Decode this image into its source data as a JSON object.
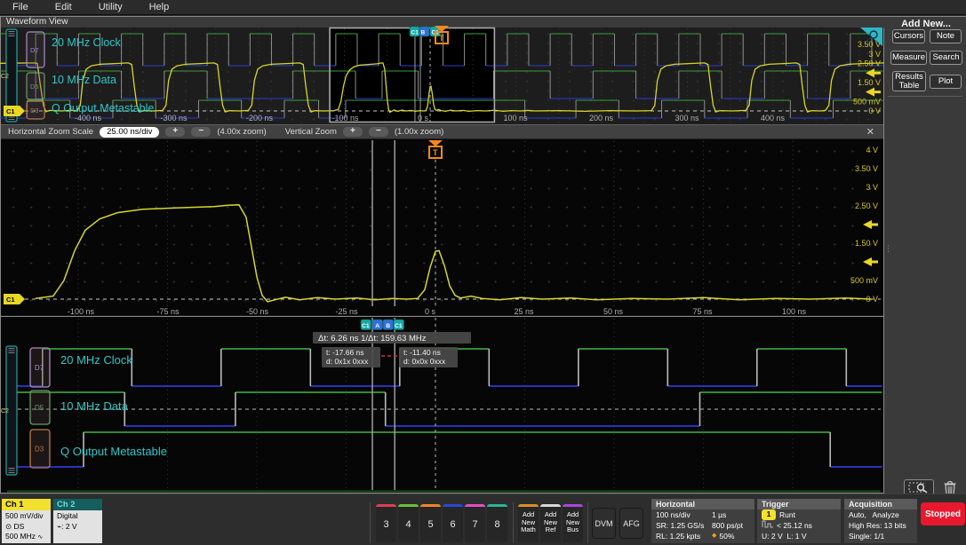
{
  "menu": {
    "items": [
      "File",
      "Edit",
      "Utility",
      "Help"
    ]
  },
  "view": {
    "title": "Waveform View"
  },
  "zoom_bar": {
    "h_label": "Horizontal Zoom Scale",
    "h_scale": "25.00 ns/div",
    "plus": "+",
    "minus": "−",
    "h_zoom": "(4.00x zoom)",
    "v_label": "Vertical Zoom",
    "v_zoom": "(1.00x zoom)",
    "close": "✕"
  },
  "sidebar": {
    "title": "Add New...",
    "buttons": [
      "Cursors",
      "Note",
      "Measure",
      "Search",
      "Results Table",
      "Plot"
    ]
  },
  "icons": {
    "grip": "≡",
    "dots": "⋮",
    "probe": "⊙",
    "bandwidth": "∿",
    "threshold": "⌁",
    "position": "◆"
  },
  "statusbar": {
    "ch1": {
      "name": "Ch 1",
      "line1": "500 mV/div",
      "line2": "DS",
      "line3": "500 MHz",
      "accent": "#f2e12e"
    },
    "ch2": {
      "name": "Ch 2",
      "line1": "Digital",
      "line2": ": 2 V",
      "accent": "#155e5e",
      "name_color": "#6fd9d9"
    },
    "channel_buttons": [
      {
        "n": "3",
        "c": "#e03c5a"
      },
      {
        "n": "4",
        "c": "#6cbf3c"
      },
      {
        "n": "5",
        "c": "#f08428"
      },
      {
        "n": "6",
        "c": "#2848d8"
      },
      {
        "n": "7",
        "c": "#e050c0"
      },
      {
        "n": "8",
        "c": "#28b890"
      }
    ],
    "add_new": [
      {
        "label": "Add New Math",
        "c": "#d89028"
      },
      {
        "label": "Add New Ref",
        "c": "#d8d8d8"
      },
      {
        "label": "Add New Bus",
        "c": "#a848d8"
      }
    ],
    "dvm": "DVM",
    "afg": "AFG",
    "horizontal": {
      "title": "Horizontal",
      "rows": [
        [
          "100 ns/div",
          "1 µs"
        ],
        [
          "SR: 1.25 GS/s",
          "800 ps/pt"
        ],
        [
          "RL: 1.25 kpts",
          "50%"
        ]
      ]
    },
    "trigger": {
      "title": "Trigger",
      "source": "1",
      "type": "Runt",
      "width": "< 25.12 ns",
      "levels": "U: 2 V  L: 1 V"
    },
    "acquisition": {
      "title": "Acquisition",
      "line1": "Auto,   Analyze",
      "line2": "High Res: 13 bits",
      "line3": "Single: 1/1"
    },
    "stopped": "Stopped"
  },
  "chart_data": {
    "type": "line",
    "title": "Waveform View",
    "time_unit": "ns",
    "analog_channel": {
      "id": "C1",
      "label": "Ch 1",
      "color": "#d6d62a",
      "scale": "500 mV/div"
    },
    "digital_ref": {
      "id": "C2",
      "label": "Ch 2 Digital"
    },
    "channels": [
      {
        "id": "D7",
        "label": "20 MHz Clock",
        "badge_color": "#a88cc8"
      },
      {
        "id": "D5",
        "label": "10 MHz Data",
        "badge_color": "#6a9a6a"
      },
      {
        "id": "D3",
        "label": "Q Output Metastable",
        "badge_color": "#b87848"
      }
    ],
    "overview": {
      "t_range": [
        -520,
        530
      ],
      "ticks": [
        [
          -400,
          "-400 ns"
        ],
        [
          -300,
          "-300 ns"
        ],
        [
          -200,
          "-200 ns"
        ],
        [
          -100,
          "-100 ns"
        ],
        [
          0,
          "0 s"
        ],
        [
          100,
          "100 ns"
        ],
        [
          200,
          "200 ns"
        ],
        [
          300,
          "300 ns"
        ],
        [
          400,
          "400 ns"
        ]
      ],
      "vlabels": [
        [
          3.5,
          "3.50 V"
        ],
        [
          3,
          "3 V"
        ],
        [
          2.5,
          "2.50 V"
        ],
        [
          1.5,
          "1.50 V"
        ],
        [
          0.5,
          "500 mV"
        ],
        [
          0,
          "0 V"
        ]
      ],
      "zoom_box_t": [
        -117,
        75
      ]
    },
    "zoom": {
      "ticks": [
        [
          -100,
          "-100 ns"
        ],
        [
          -75,
          "-75 ns"
        ],
        [
          -50,
          "-50 ns"
        ],
        [
          -25,
          "-25 ns"
        ],
        [
          0,
          "0 s"
        ],
        [
          25,
          "25 ns"
        ],
        [
          50,
          "50 ns"
        ],
        [
          75,
          "75 ns"
        ],
        [
          100,
          "100 ns"
        ]
      ],
      "vlabels": [
        [
          4,
          "4 V"
        ],
        [
          3.5,
          "3.50 V"
        ],
        [
          3,
          "3 V"
        ],
        [
          2.5,
          "2.50 V"
        ],
        [
          1.5,
          "1.50 V"
        ],
        [
          0.5,
          "500 mV"
        ],
        [
          0,
          "0 V"
        ]
      ]
    },
    "trigger": {
      "t": 0,
      "upper_v": 2,
      "lower_v": 1,
      "marker": "T",
      "color": "#f28a1e"
    },
    "cursors": {
      "a_t": -17.66,
      "b_t": -11.4,
      "badges": [
        "C1",
        "A",
        "B",
        "C1"
      ],
      "dt_label": "Δt:  6.26 ns",
      "inv_dt_label": "1/Δt:  159.63 MHz",
      "a": {
        "t": "t: -17.66 ns",
        "d": "d: 0x1x 0xxx"
      },
      "b": {
        "t": "t: -11.40 ns",
        "d": "d: 0x0x 0xxx"
      }
    },
    "analog_points": [
      [
        -520,
        2.5
      ],
      [
        -462,
        2.53
      ],
      [
        -458,
        2.5
      ],
      [
        -454,
        1.2
      ],
      [
        -451,
        0.3
      ],
      [
        -448,
        -0.04
      ],
      [
        -444,
        0.03
      ],
      [
        -430,
        0
      ],
      [
        -418,
        0.04
      ],
      [
        -412,
        0
      ],
      [
        -408,
        0.3
      ],
      [
        -405,
        1.6
      ],
      [
        -401,
        2.2
      ],
      [
        -395,
        2.38
      ],
      [
        -385,
        2.46
      ],
      [
        -365,
        2.5
      ],
      [
        -352,
        2.53
      ],
      [
        -348,
        2.45
      ],
      [
        -345,
        1.3
      ],
      [
        -342,
        0.3
      ],
      [
        -339,
        -0.05
      ],
      [
        -334,
        0.02
      ],
      [
        -322,
        0
      ],
      [
        -312,
        0.03
      ],
      [
        -308,
        0.3
      ],
      [
        -305,
        1.6
      ],
      [
        -301,
        2.2
      ],
      [
        -295,
        2.38
      ],
      [
        -285,
        2.46
      ],
      [
        -265,
        2.5
      ],
      [
        -252,
        2.53
      ],
      [
        -248,
        2.45
      ],
      [
        -245,
        1.3
      ],
      [
        -242,
        0.3
      ],
      [
        -239,
        -0.05
      ],
      [
        -234,
        0.02
      ],
      [
        -222,
        0
      ],
      [
        -212,
        0.03
      ],
      [
        -208,
        0.3
      ],
      [
        -205,
        1.6
      ],
      [
        -201,
        2.2
      ],
      [
        -195,
        2.38
      ],
      [
        -185,
        2.46
      ],
      [
        -165,
        2.5
      ],
      [
        -152,
        2.53
      ],
      [
        -148,
        2.45
      ],
      [
        -145,
        1.3
      ],
      [
        -142,
        0.3
      ],
      [
        -139,
        -0.05
      ],
      [
        -134,
        0.02
      ],
      [
        -124,
        0
      ],
      [
        -112,
        0.02
      ],
      [
        -107,
        0.08
      ],
      [
        -104,
        0.5
      ],
      [
        -101,
        1.3
      ],
      [
        -98,
        1.85
      ],
      [
        -94,
        2.15
      ],
      [
        -89,
        2.32
      ],
      [
        -82,
        2.41
      ],
      [
        -72,
        2.45
      ],
      [
        -62,
        2.48
      ],
      [
        -58,
        2.52
      ],
      [
        -55,
        2.53
      ],
      [
        -53,
        2.2
      ],
      [
        -51.5,
        1.4
      ],
      [
        -50,
        0.6
      ],
      [
        -48.5,
        0.1
      ],
      [
        -47,
        -0.07
      ],
      [
        -45,
        -0.02
      ],
      [
        -42,
        0.05
      ],
      [
        -38,
        -0.02
      ],
      [
        -33,
        0.04
      ],
      [
        -28,
        0
      ],
      [
        -22,
        0.03
      ],
      [
        -17,
        -0.02
      ],
      [
        -12,
        0.02
      ],
      [
        -8,
        0
      ],
      [
        -5,
        0.02
      ],
      [
        -3,
        0.25
      ],
      [
        -1.5,
        0.85
      ],
      [
        0,
        1.28
      ],
      [
        1,
        1.3
      ],
      [
        2.5,
        0.9
      ],
      [
        4,
        0.35
      ],
      [
        5.5,
        0.1
      ],
      [
        7,
        0.03
      ],
      [
        10,
        0.08
      ],
      [
        13,
        0.02
      ],
      [
        18,
        -0.02
      ],
      [
        24,
        0.04
      ],
      [
        30,
        0
      ],
      [
        38,
        0.03
      ],
      [
        45,
        -0.02
      ],
      [
        55,
        0.02
      ],
      [
        65,
        0
      ],
      [
        75,
        0.04
      ],
      [
        85,
        -0.02
      ],
      [
        95,
        0.02
      ],
      [
        105,
        0
      ],
      [
        115,
        0.03
      ],
      [
        122,
        0
      ],
      [
        150,
        0.02
      ],
      [
        180,
        -0.02
      ],
      [
        210,
        0.02
      ],
      [
        240,
        0
      ],
      [
        258,
        0.02
      ],
      [
        262,
        0.3
      ],
      [
        265,
        1.6
      ],
      [
        269,
        2.2
      ],
      [
        275,
        2.38
      ],
      [
        285,
        2.46
      ],
      [
        305,
        2.5
      ],
      [
        320,
        2.53
      ],
      [
        324,
        2.45
      ],
      [
        327,
        1.3
      ],
      [
        330,
        0.3
      ],
      [
        333,
        -0.05
      ],
      [
        338,
        0.02
      ],
      [
        352,
        0
      ],
      [
        368,
        0.03
      ],
      [
        372,
        0.3
      ],
      [
        375,
        1.6
      ],
      [
        379,
        2.2
      ],
      [
        385,
        2.38
      ],
      [
        395,
        2.46
      ],
      [
        415,
        2.5
      ],
      [
        427,
        2.53
      ],
      [
        431,
        2.45
      ],
      [
        434,
        1.3
      ],
      [
        437,
        0.3
      ],
      [
        440,
        -0.05
      ],
      [
        445,
        0.02
      ],
      [
        455,
        0
      ],
      [
        461,
        0.03
      ],
      [
        465,
        0.3
      ],
      [
        468,
        1.6
      ],
      [
        472,
        2.2
      ],
      [
        478,
        2.38
      ],
      [
        488,
        2.46
      ],
      [
        505,
        2.5
      ],
      [
        530,
        2.53
      ]
    ],
    "digital": {
      "d7": {
        "start": 0,
        "edges": [
          [
            -510,
            1
          ],
          [
            -485,
            0
          ],
          [
            -460,
            1
          ],
          [
            -435,
            0
          ],
          [
            -410,
            1
          ],
          [
            -385,
            0
          ],
          [
            -360,
            1
          ],
          [
            -335,
            0
          ],
          [
            -310,
            1
          ],
          [
            -285,
            0
          ],
          [
            -260,
            1
          ],
          [
            -235,
            0
          ],
          [
            -210,
            1
          ],
          [
            -185,
            0
          ],
          [
            -160,
            1
          ],
          [
            -135,
            0
          ],
          [
            -110,
            1
          ],
          [
            -85,
            0
          ],
          [
            -60,
            1
          ],
          [
            -35,
            0
          ],
          [
            -10,
            1
          ],
          [
            15,
            0
          ],
          [
            40,
            1
          ],
          [
            65,
            0
          ],
          [
            90,
            1
          ],
          [
            115,
            0
          ],
          [
            140,
            1
          ],
          [
            165,
            0
          ],
          [
            190,
            1
          ],
          [
            215,
            0
          ],
          [
            240,
            1
          ],
          [
            265,
            0
          ],
          [
            290,
            1
          ],
          [
            315,
            0
          ],
          [
            340,
            1
          ],
          [
            365,
            0
          ],
          [
            390,
            1
          ],
          [
            415,
            0
          ],
          [
            440,
            1
          ],
          [
            465,
            0
          ],
          [
            490,
            1
          ],
          [
            515,
            0
          ]
        ]
      },
      "d5": {
        "start": 1,
        "edges": [
          [
            -460,
            0
          ],
          [
            -410,
            1
          ],
          [
            -360,
            0
          ],
          [
            -310,
            1
          ],
          [
            -260,
            0
          ],
          [
            -160,
            1
          ],
          [
            -87,
            0
          ],
          [
            -56,
            1
          ],
          [
            -14,
            0
          ],
          [
            74,
            1
          ],
          [
            140,
            0
          ],
          [
            190,
            1
          ],
          [
            240,
            0
          ],
          [
            290,
            1
          ],
          [
            340,
            0
          ],
          [
            390,
            1
          ],
          [
            440,
            0
          ],
          [
            490,
            1
          ]
        ]
      },
      "d3": {
        "start": 0,
        "edges": [
          [
            -470,
            1
          ],
          [
            -420,
            0
          ],
          [
            -370,
            1
          ],
          [
            -320,
            0
          ],
          [
            -270,
            1
          ],
          [
            -220,
            0
          ],
          [
            -170,
            1
          ],
          [
            -130,
            0
          ],
          [
            -98.5,
            1
          ],
          [
            110.5,
            0
          ],
          [
            170,
            1
          ],
          [
            220,
            0
          ],
          [
            270,
            1
          ],
          [
            320,
            0
          ],
          [
            370,
            1
          ],
          [
            420,
            0
          ],
          [
            470,
            1
          ]
        ]
      }
    }
  }
}
